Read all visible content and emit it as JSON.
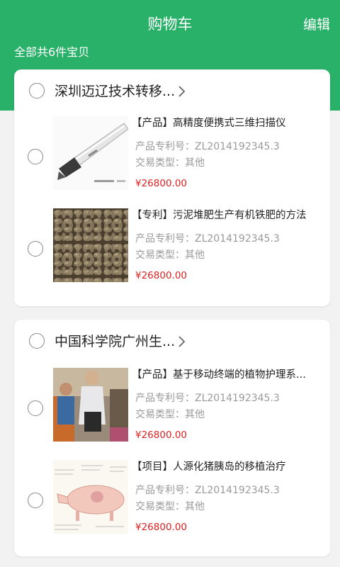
{
  "header": {
    "title": "购物车",
    "edit_label": "编辑",
    "total_text": "全部共6件宝贝",
    "bg_color": "#29b069"
  },
  "stores": [
    {
      "name": "深圳迈辽技术转移...",
      "items": [
        {
          "title": "【产品】高精度便携式三维扫描仪",
          "patent": "产品专利号：ZL2014192345.3",
          "trade_type": "交易类型：其他",
          "price": "¥26800.00",
          "image": "handheld-3d-scanner-photo"
        },
        {
          "title": "【专利】污泥堆肥生产有机铁肥的方法",
          "patent": "产品专利号：ZL2014192345.3",
          "trade_type": "交易类型：其他",
          "price": "¥26800.00",
          "image": "fertilizer-pellets-photo"
        }
      ]
    },
    {
      "name": "中国科学院广州生...",
      "items": [
        {
          "title": "【产品】基于移动终端的植物护理系...",
          "patent": "产品专利号：ZL2014192345.3",
          "trade_type": "交易类型：其他",
          "price": "¥26800.00",
          "image": "people-with-device-photo"
        },
        {
          "title": "【项目】人源化猪胰岛的移植治疗",
          "patent": "产品专利号：ZL2014192345.3",
          "trade_type": "交易类型：其他",
          "price": "¥26800.00",
          "image": "pig-anatomy-illustration"
        }
      ]
    }
  ],
  "price_color": "#e02020",
  "icons": {
    "store_select": "radio-circle-icon",
    "store_arrow": "chevron-right-icon",
    "item_select": "radio-circle-icon"
  }
}
